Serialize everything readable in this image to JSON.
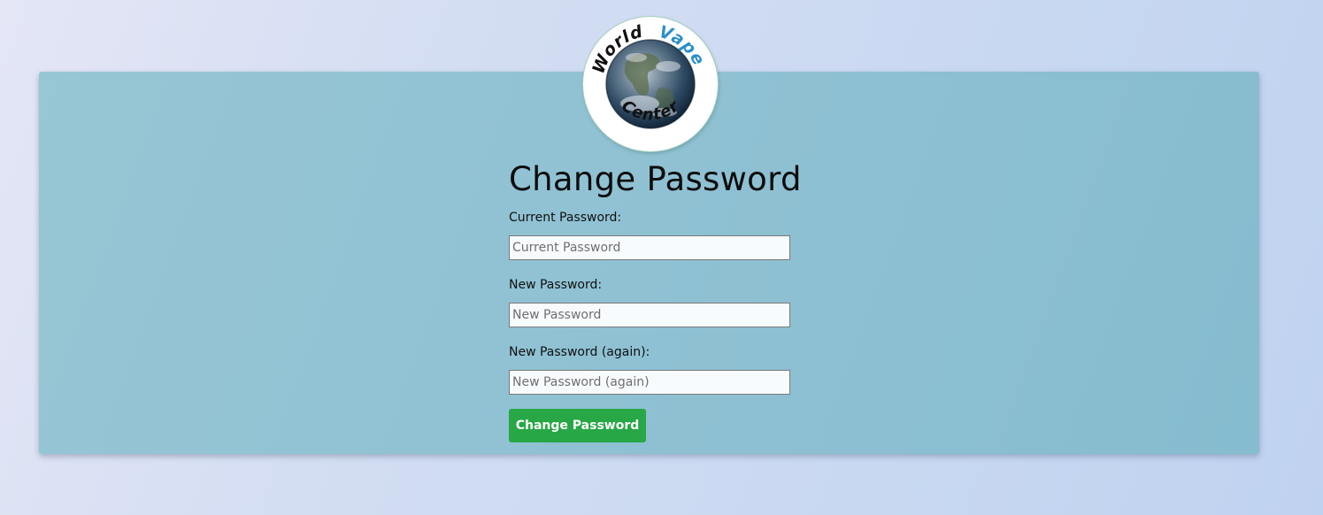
{
  "logo": {
    "text_world": "World",
    "text_vape": "Vape",
    "text_center": "Center",
    "colors": {
      "world": "#111111",
      "vape": "#2b8fc9",
      "center": "#111111",
      "ring": "#a7cfc0"
    }
  },
  "form": {
    "title": "Change Password",
    "fields": [
      {
        "label": "Current Password:",
        "placeholder": "Current Password",
        "value": ""
      },
      {
        "label": "New Password:",
        "placeholder": "New Password",
        "value": ""
      },
      {
        "label": "New Password (again):",
        "placeholder": "New Password (again)",
        "value": ""
      }
    ],
    "submit_label": "Change Password"
  },
  "colors": {
    "card_background": "#8fc1d3",
    "submit_button": "#27a745",
    "page_background": "#d2ddf2"
  }
}
